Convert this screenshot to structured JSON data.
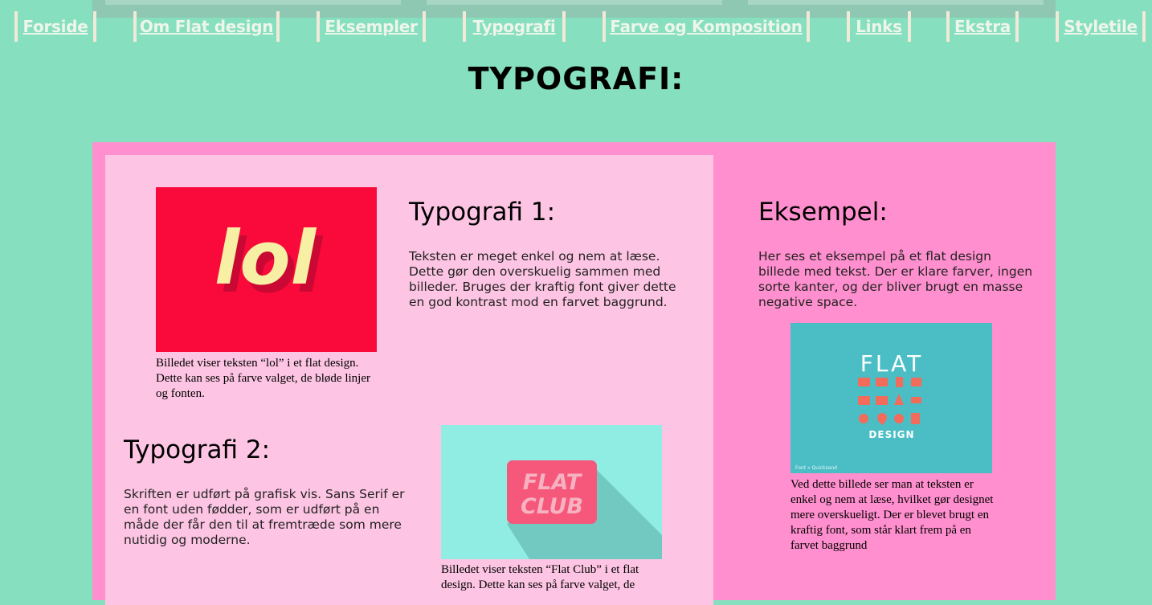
{
  "nav": {
    "items": [
      {
        "label": "Forside"
      },
      {
        "label": "Om Flat design"
      },
      {
        "label": "Eksempler"
      },
      {
        "label": "Typografi"
      },
      {
        "label": "Farve og Komposition"
      },
      {
        "label": "Links"
      },
      {
        "label": "Ekstra"
      },
      {
        "label": "Styletile"
      }
    ]
  },
  "page": {
    "title": "TYPOGRAFI:"
  },
  "section1": {
    "heading": "Typografi 1:",
    "text": "Teksten er meget enkel og nem at læse. Dette gør den overskuelig sammen med billeder. Bruges der kraftig font giver dette en god kontrast mod en farvet baggrund.",
    "image_text": "lol",
    "caption": "Billedet viser teksten “lol” i et flat design. Dette kan ses på farve valget, de bløde linjer og fonten."
  },
  "section2": {
    "heading": "Typografi 2:",
    "text": "Skriften er udført på grafisk vis. Sans Serif er en font uden fødder, som er udført på en måde der får den til at fremtræde som mere nutidig og moderne.",
    "image_line1": "FLAT",
    "image_line2": "CLUB",
    "caption": "Billedet viser teksten “Flat Club” i et flat design. Dette kan ses på farve valget, de"
  },
  "example": {
    "heading": "Eksempel:",
    "text": "Her ses et eksempel på et flat design billede med tekst. Der er klare farver, ingen sorte kanter, og der bliver brugt en masse negative space.",
    "image_title": "FLAT",
    "image_subtitle": "DESIGN",
    "image_credit": "Font » Quicksand",
    "caption": "Ved dette billede ser man at teksten er enkel og nem at læse, hvilket gør designet mere overskueligt. Der er blevet brugt en kraftig font, som står klart frem på en farvet baggrund"
  },
  "colors": {
    "background": "#86dfbe",
    "outer_panel": "#ff8fce",
    "inner_panel": "#fdc5e3",
    "lol_bg": "#f90a3b",
    "lol_text": "#f7f0a4",
    "club_bg": "#90ede3",
    "club_badge": "#f5587a",
    "flat_bg": "#4bbec5"
  }
}
